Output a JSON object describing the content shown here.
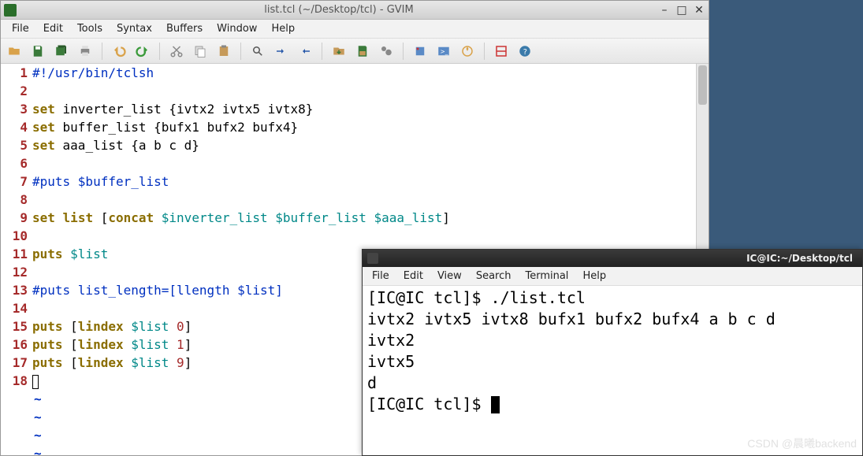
{
  "gvim": {
    "title": "list.tcl (~/Desktop/tcl) - GVIM",
    "menu": [
      "File",
      "Edit",
      "Tools",
      "Syntax",
      "Buffers",
      "Window",
      "Help"
    ],
    "code": [
      {
        "n": 1,
        "tokens": [
          {
            "t": "#!/usr/bin/tclsh",
            "c": "c-blue"
          }
        ]
      },
      {
        "n": 2,
        "tokens": []
      },
      {
        "n": 3,
        "tokens": [
          {
            "t": "set",
            "c": "c-keyword"
          },
          {
            "t": " inverter_list {ivtx2 ivtx5 ivtx8}",
            "c": "c-black"
          }
        ]
      },
      {
        "n": 4,
        "tokens": [
          {
            "t": "set",
            "c": "c-keyword"
          },
          {
            "t": " buffer_list {bufx1 bufx2 bufx4}",
            "c": "c-black"
          }
        ]
      },
      {
        "n": 5,
        "tokens": [
          {
            "t": "set",
            "c": "c-keyword"
          },
          {
            "t": " aaa_list {a b c d}",
            "c": "c-black"
          }
        ]
      },
      {
        "n": 6,
        "tokens": []
      },
      {
        "n": 7,
        "tokens": [
          {
            "t": "#puts $buffer_list",
            "c": "c-blue"
          }
        ]
      },
      {
        "n": 8,
        "tokens": []
      },
      {
        "n": 9,
        "tokens": [
          {
            "t": "set",
            "c": "c-keyword"
          },
          {
            "t": " ",
            "c": "c-black"
          },
          {
            "t": "list",
            "c": "c-keyword"
          },
          {
            "t": " [",
            "c": "c-black"
          },
          {
            "t": "concat",
            "c": "c-keyword"
          },
          {
            "t": " ",
            "c": "c-black"
          },
          {
            "t": "$inverter_list",
            "c": "c-teal"
          },
          {
            "t": " ",
            "c": "c-black"
          },
          {
            "t": "$buffer_list",
            "c": "c-teal"
          },
          {
            "t": " ",
            "c": "c-black"
          },
          {
            "t": "$aaa_list",
            "c": "c-teal"
          },
          {
            "t": "]",
            "c": "c-black"
          }
        ]
      },
      {
        "n": 10,
        "tokens": []
      },
      {
        "n": 11,
        "tokens": [
          {
            "t": "puts",
            "c": "c-keyword"
          },
          {
            "t": " ",
            "c": "c-black"
          },
          {
            "t": "$list",
            "c": "c-teal"
          }
        ]
      },
      {
        "n": 12,
        "tokens": []
      },
      {
        "n": 13,
        "tokens": [
          {
            "t": "#puts list_length=[llength $list]",
            "c": "c-blue"
          }
        ]
      },
      {
        "n": 14,
        "tokens": []
      },
      {
        "n": 15,
        "tokens": [
          {
            "t": "puts",
            "c": "c-keyword"
          },
          {
            "t": " [",
            "c": "c-black"
          },
          {
            "t": "lindex",
            "c": "c-keyword"
          },
          {
            "t": " ",
            "c": "c-black"
          },
          {
            "t": "$list",
            "c": "c-teal"
          },
          {
            "t": " ",
            "c": "c-black"
          },
          {
            "t": "0",
            "c": "c-red"
          },
          {
            "t": "]",
            "c": "c-black"
          }
        ]
      },
      {
        "n": 16,
        "tokens": [
          {
            "t": "puts",
            "c": "c-keyword"
          },
          {
            "t": " [",
            "c": "c-black"
          },
          {
            "t": "lindex",
            "c": "c-keyword"
          },
          {
            "t": " ",
            "c": "c-black"
          },
          {
            "t": "$list",
            "c": "c-teal"
          },
          {
            "t": " ",
            "c": "c-black"
          },
          {
            "t": "1",
            "c": "c-red"
          },
          {
            "t": "]",
            "c": "c-black"
          }
        ]
      },
      {
        "n": 17,
        "tokens": [
          {
            "t": "puts",
            "c": "c-keyword"
          },
          {
            "t": " [",
            "c": "c-black"
          },
          {
            "t": "lindex",
            "c": "c-keyword"
          },
          {
            "t": " ",
            "c": "c-black"
          },
          {
            "t": "$list",
            "c": "c-teal"
          },
          {
            "t": " ",
            "c": "c-black"
          },
          {
            "t": "9",
            "c": "c-red"
          },
          {
            "t": "]",
            "c": "c-black"
          }
        ]
      },
      {
        "n": 18,
        "tokens": [
          {
            "t": "",
            "c": "c-black",
            "cursor": true
          }
        ]
      }
    ],
    "tildes": 4
  },
  "terminal": {
    "title": "IC@IC:~/Desktop/tcl",
    "menu": [
      "File",
      "Edit",
      "View",
      "Search",
      "Terminal",
      "Help"
    ],
    "lines": [
      "[IC@IC tcl]$ ./list.tcl",
      "ivtx2 ivtx5 ivtx8 bufx1 bufx2 bufx4 a b c d",
      "ivtx2",
      "ivtx5",
      "d",
      "[IC@IC tcl]$ "
    ]
  },
  "watermark": "CSDN @晨曦backend"
}
